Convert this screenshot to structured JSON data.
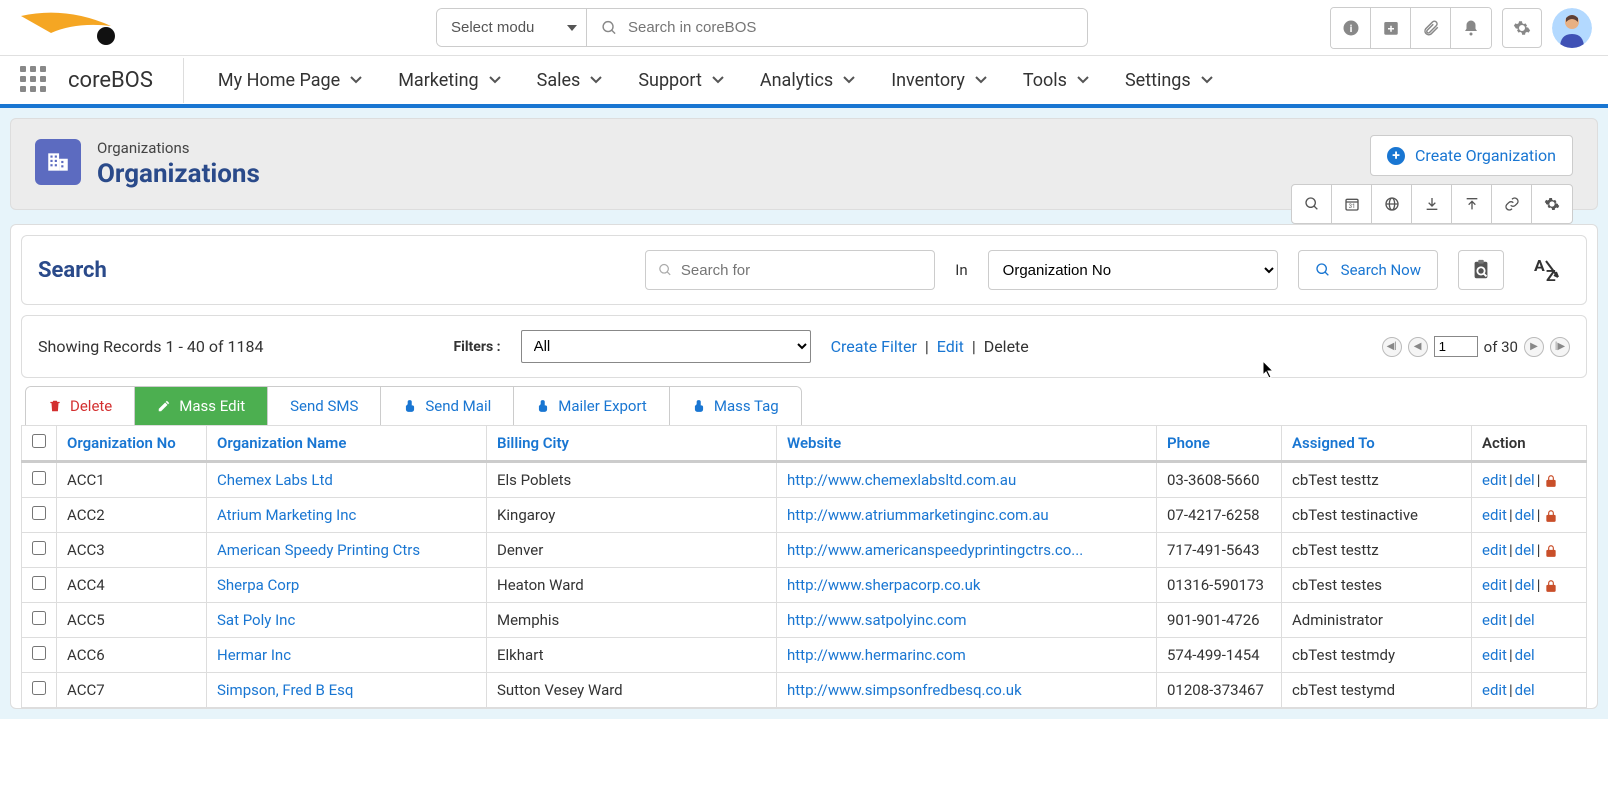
{
  "top": {
    "module_select_placeholder": "Select modu",
    "search_placeholder": "Search in coreBOS"
  },
  "nav": {
    "brand": "coreBOS",
    "items": [
      "My Home Page",
      "Marketing",
      "Sales",
      "Support",
      "Analytics",
      "Inventory",
      "Tools",
      "Settings"
    ]
  },
  "header": {
    "breadcrumb": "Organizations",
    "title": "Organizations",
    "create_label": "Create Organization"
  },
  "search": {
    "title": "Search",
    "placeholder": "Search for",
    "in_label": "In",
    "in_value": "Organization No",
    "search_now": "Search Now"
  },
  "filter": {
    "showing": "Showing Records 1 - 40 of 1184",
    "filters_label": "Filters :",
    "filter_value": "All",
    "create_filter": "Create Filter",
    "edit": "Edit",
    "delete": "Delete",
    "page": "1",
    "of_label": "of 30"
  },
  "bulk": {
    "delete": "Delete",
    "mass_edit": "Mass Edit",
    "send_sms": "Send SMS",
    "send_mail": "Send Mail",
    "mailer_export": "Mailer Export",
    "mass_tag": "Mass Tag"
  },
  "columns": {
    "org_no": "Organization No",
    "org_name": "Organization Name",
    "billing_city": "Billing City",
    "website": "Website",
    "phone": "Phone",
    "assigned": "Assigned To",
    "action": "Action"
  },
  "actions": {
    "edit": "edit",
    "del": "del"
  },
  "rows": [
    {
      "no": "ACC1",
      "name": "Chemex Labs Ltd",
      "city": "Els Poblets",
      "site": "http://www.chemexlabsltd.com.au",
      "phone": "03-3608-5660",
      "assigned": "cbTest testtz",
      "lock": true
    },
    {
      "no": "ACC2",
      "name": "Atrium Marketing Inc",
      "city": "Kingaroy",
      "site": "http://www.atriummarketinginc.com.au",
      "phone": "07-4217-6258",
      "assigned": "cbTest testinactive",
      "lock": true
    },
    {
      "no": "ACC3",
      "name": "American Speedy Printing Ctrs",
      "city": "Denver",
      "site": "http://www.americanspeedyprintingctrs.co...",
      "phone": "717-491-5643",
      "assigned": "cbTest testtz",
      "lock": true
    },
    {
      "no": "ACC4",
      "name": "Sherpa Corp",
      "city": "Heaton Ward",
      "site": "http://www.sherpacorp.co.uk",
      "phone": "01316-590173",
      "assigned": "cbTest testes",
      "lock": true
    },
    {
      "no": "ACC5",
      "name": "Sat Poly Inc",
      "city": "Memphis",
      "site": "http://www.satpolyinc.com",
      "phone": "901-901-4726",
      "assigned": "Administrator",
      "lock": false
    },
    {
      "no": "ACC6",
      "name": "Hermar Inc",
      "city": "Elkhart",
      "site": "http://www.hermarinc.com",
      "phone": "574-499-1454",
      "assigned": "cbTest testmdy",
      "lock": false
    },
    {
      "no": "ACC7",
      "name": "Simpson, Fred B Esq",
      "city": "Sutton Vesey Ward",
      "site": "http://www.simpsonfredbesq.co.uk",
      "phone": "01208-373467",
      "assigned": "cbTest testymd",
      "lock": false
    }
  ]
}
